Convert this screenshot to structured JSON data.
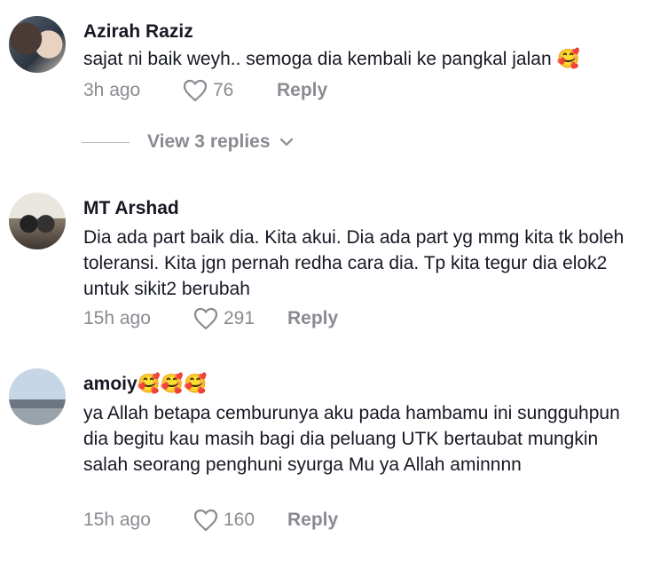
{
  "comments": [
    {
      "username": "Azirah Raziz",
      "text": "sajat ni baik weyh.. semoga dia kembali ke pangkal jalan 🥰",
      "time": "3h ago",
      "likes": "76",
      "reply_label": "Reply"
    },
    {
      "username": "MT Arshad",
      "text": "Dia ada part baik dia. Kita akui. Dia ada part yg mmg kita tk boleh toleransi. Kita jgn pernah redha cara dia. Tp kita tegur dia elok2 untuk sikit2 berubah",
      "time": "15h ago",
      "likes": "291",
      "reply_label": "Reply"
    },
    {
      "username": "amoiy🥰🥰🥰",
      "text": "ya Allah betapa cemburunya aku pada hambamu ini sungguhpun dia begitu kau masih bagi dia peluang UTK bertaubat mungkin salah seorang penghuni syurga Mu ya Allah aminnnn",
      "time": "15h ago",
      "likes": "160",
      "reply_label": "Reply"
    }
  ],
  "view_replies": "View 3 replies",
  "icons": {
    "like": "heart-outline-icon",
    "expand": "chevron-down-icon"
  },
  "colors": {
    "text": "#161823",
    "muted": "#8a8b91"
  }
}
